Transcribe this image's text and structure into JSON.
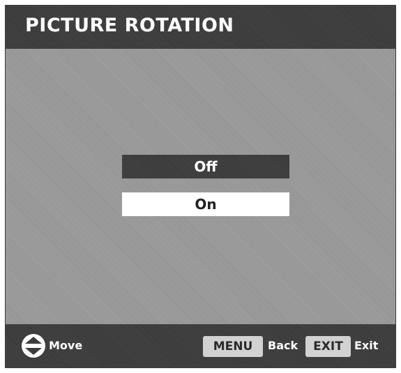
{
  "header": {
    "title": "PICTURE ROTATION"
  },
  "options": {
    "items": [
      {
        "label": "Off",
        "highlighted": true
      },
      {
        "label": "On",
        "highlighted": false
      }
    ]
  },
  "footer": {
    "move_icon": "up-down-arrow-circle-icon",
    "move_label": "Move",
    "menu_key": "MENU",
    "back_label": "Back",
    "exit_key": "EXIT",
    "exit_label": "Exit"
  },
  "colors": {
    "bar_background": "#3c3c3c",
    "screen_background": "#9a9a9a",
    "selected_option_background": "#3c3c3c",
    "unselected_option_background": "#ffffff",
    "key_button_background": "#d2d2d2"
  }
}
